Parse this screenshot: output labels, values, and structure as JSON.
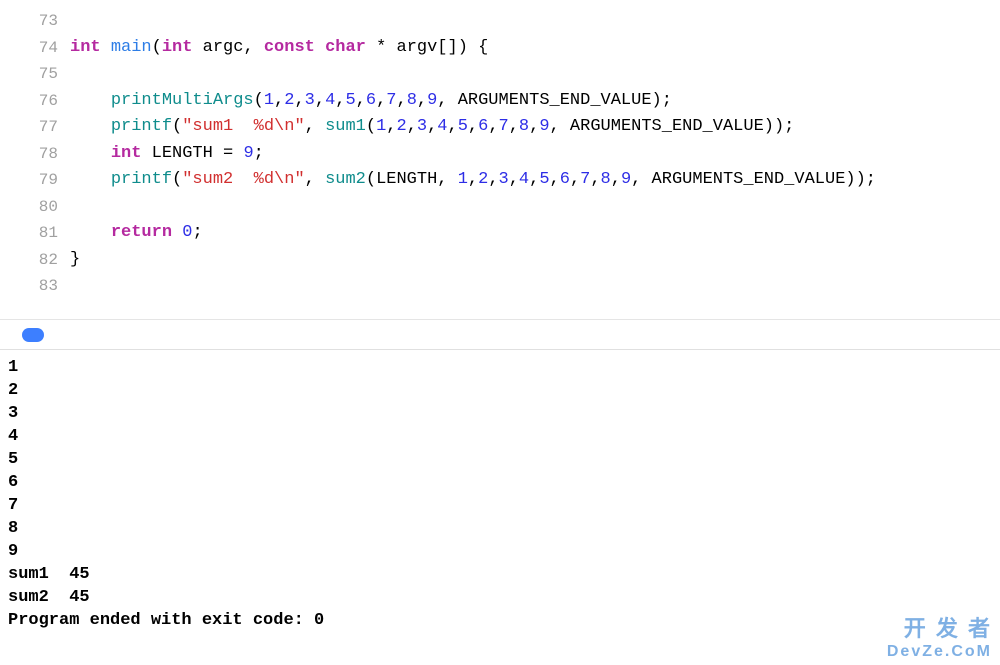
{
  "editor": {
    "lines": [
      {
        "num": "73",
        "tokens": []
      },
      {
        "num": "74",
        "tokens": [
          {
            "t": "kw",
            "v": "int"
          },
          {
            "t": "plain",
            "v": " "
          },
          {
            "t": "id",
            "v": "main"
          },
          {
            "t": "plain",
            "v": "("
          },
          {
            "t": "kw",
            "v": "int"
          },
          {
            "t": "plain",
            "v": " argc, "
          },
          {
            "t": "kw",
            "v": "const"
          },
          {
            "t": "plain",
            "v": " "
          },
          {
            "t": "kw",
            "v": "char"
          },
          {
            "t": "plain",
            "v": " * argv[]) {"
          }
        ]
      },
      {
        "num": "75",
        "tokens": []
      },
      {
        "num": "76",
        "tokens": [
          {
            "t": "plain",
            "v": "    "
          },
          {
            "t": "fn",
            "v": "printMultiArgs"
          },
          {
            "t": "plain",
            "v": "("
          },
          {
            "t": "num",
            "v": "1"
          },
          {
            "t": "plain",
            "v": ","
          },
          {
            "t": "num",
            "v": "2"
          },
          {
            "t": "plain",
            "v": ","
          },
          {
            "t": "num",
            "v": "3"
          },
          {
            "t": "plain",
            "v": ","
          },
          {
            "t": "num",
            "v": "4"
          },
          {
            "t": "plain",
            "v": ","
          },
          {
            "t": "num",
            "v": "5"
          },
          {
            "t": "plain",
            "v": ","
          },
          {
            "t": "num",
            "v": "6"
          },
          {
            "t": "plain",
            "v": ","
          },
          {
            "t": "num",
            "v": "7"
          },
          {
            "t": "plain",
            "v": ","
          },
          {
            "t": "num",
            "v": "8"
          },
          {
            "t": "plain",
            "v": ","
          },
          {
            "t": "num",
            "v": "9"
          },
          {
            "t": "plain",
            "v": ", ARGUMENTS_END_VALUE);"
          }
        ]
      },
      {
        "num": "77",
        "tokens": [
          {
            "t": "plain",
            "v": "    "
          },
          {
            "t": "fn",
            "v": "printf"
          },
          {
            "t": "plain",
            "v": "("
          },
          {
            "t": "str",
            "v": "\"sum1  %d\\n\""
          },
          {
            "t": "plain",
            "v": ", "
          },
          {
            "t": "fn",
            "v": "sum1"
          },
          {
            "t": "plain",
            "v": "("
          },
          {
            "t": "num",
            "v": "1"
          },
          {
            "t": "plain",
            "v": ","
          },
          {
            "t": "num",
            "v": "2"
          },
          {
            "t": "plain",
            "v": ","
          },
          {
            "t": "num",
            "v": "3"
          },
          {
            "t": "plain",
            "v": ","
          },
          {
            "t": "num",
            "v": "4"
          },
          {
            "t": "plain",
            "v": ","
          },
          {
            "t": "num",
            "v": "5"
          },
          {
            "t": "plain",
            "v": ","
          },
          {
            "t": "num",
            "v": "6"
          },
          {
            "t": "plain",
            "v": ","
          },
          {
            "t": "num",
            "v": "7"
          },
          {
            "t": "plain",
            "v": ","
          },
          {
            "t": "num",
            "v": "8"
          },
          {
            "t": "plain",
            "v": ","
          },
          {
            "t": "num",
            "v": "9"
          },
          {
            "t": "plain",
            "v": ", ARGUMENTS_END_VALUE));"
          }
        ]
      },
      {
        "num": "78",
        "tokens": [
          {
            "t": "plain",
            "v": "    "
          },
          {
            "t": "kw",
            "v": "int"
          },
          {
            "t": "plain",
            "v": " LENGTH = "
          },
          {
            "t": "num",
            "v": "9"
          },
          {
            "t": "plain",
            "v": ";"
          }
        ]
      },
      {
        "num": "79",
        "tokens": [
          {
            "t": "plain",
            "v": "    "
          },
          {
            "t": "fn",
            "v": "printf"
          },
          {
            "t": "plain",
            "v": "("
          },
          {
            "t": "str",
            "v": "\"sum2  %d\\n\""
          },
          {
            "t": "plain",
            "v": ", "
          },
          {
            "t": "fn",
            "v": "sum2"
          },
          {
            "t": "plain",
            "v": "(LENGTH, "
          },
          {
            "t": "num",
            "v": "1"
          },
          {
            "t": "plain",
            "v": ","
          },
          {
            "t": "num",
            "v": "2"
          },
          {
            "t": "plain",
            "v": ","
          },
          {
            "t": "num",
            "v": "3"
          },
          {
            "t": "plain",
            "v": ","
          },
          {
            "t": "num",
            "v": "4"
          },
          {
            "t": "plain",
            "v": ","
          },
          {
            "t": "num",
            "v": "5"
          },
          {
            "t": "plain",
            "v": ","
          },
          {
            "t": "num",
            "v": "6"
          },
          {
            "t": "plain",
            "v": ","
          },
          {
            "t": "num",
            "v": "7"
          },
          {
            "t": "plain",
            "v": ","
          },
          {
            "t": "num",
            "v": "8"
          },
          {
            "t": "plain",
            "v": ","
          },
          {
            "t": "num",
            "v": "9"
          },
          {
            "t": "plain",
            "v": ", ARGUMENTS_END_VALUE));"
          }
        ]
      },
      {
        "num": "80",
        "tokens": []
      },
      {
        "num": "81",
        "tokens": [
          {
            "t": "plain",
            "v": "    "
          },
          {
            "t": "kw",
            "v": "return"
          },
          {
            "t": "plain",
            "v": " "
          },
          {
            "t": "num",
            "v": "0"
          },
          {
            "t": "plain",
            "v": ";"
          }
        ]
      },
      {
        "num": "82",
        "tokens": [
          {
            "t": "plain",
            "v": "}"
          }
        ]
      },
      {
        "num": "83",
        "tokens": []
      }
    ]
  },
  "console": {
    "lines": [
      "1",
      "2",
      "3",
      "4",
      "5",
      "6",
      "7",
      "8",
      "9",
      "sum1  45",
      "sum2  45",
      "Program ended with exit code: 0"
    ]
  },
  "watermark": {
    "line1": "开 发 者",
    "line2": "DevZe.CoM"
  }
}
